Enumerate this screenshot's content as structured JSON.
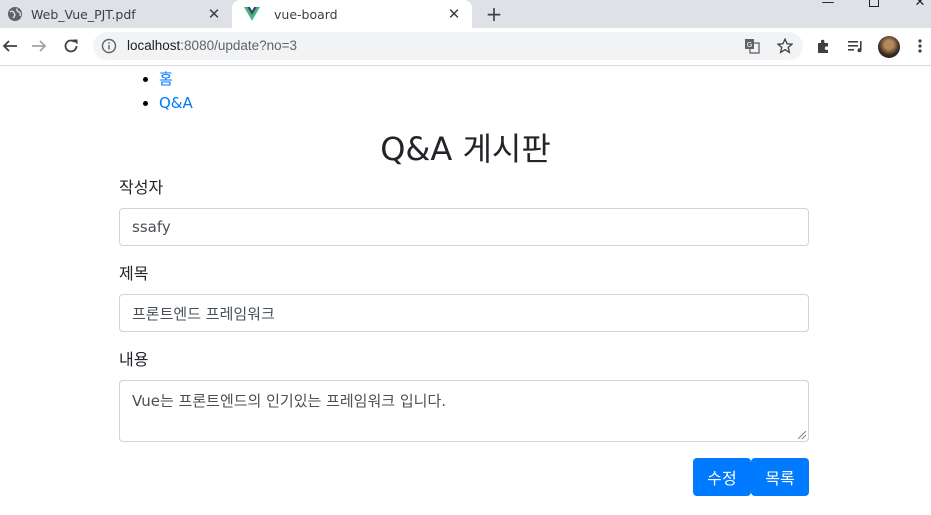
{
  "browser": {
    "tabs": [
      {
        "title": "Web_Vue_PJT.pdf",
        "icon": "globe-icon",
        "active": false
      },
      {
        "title": "vue-board",
        "icon": "vue-logo-icon",
        "active": true
      }
    ],
    "address": {
      "host": "localhost",
      "rest": ":8080/update?no=3"
    }
  },
  "nav": {
    "items": [
      "홈",
      "Q&A"
    ]
  },
  "page": {
    "title": "Q&A 게시판"
  },
  "form": {
    "author": {
      "label": "작성자",
      "value": "ssafy"
    },
    "subject": {
      "label": "제목",
      "value": "프론트엔드 프레임워크"
    },
    "content": {
      "label": "내용",
      "value": "Vue는 프론트엔드의 인기있는 프레임워크 입니다."
    }
  },
  "buttons": {
    "update": "수정",
    "list": "목록"
  },
  "colors": {
    "primary": "#007bff",
    "chrome": "#dee1e6",
    "vue_green": "#41b883",
    "vue_dark": "#35495e"
  }
}
